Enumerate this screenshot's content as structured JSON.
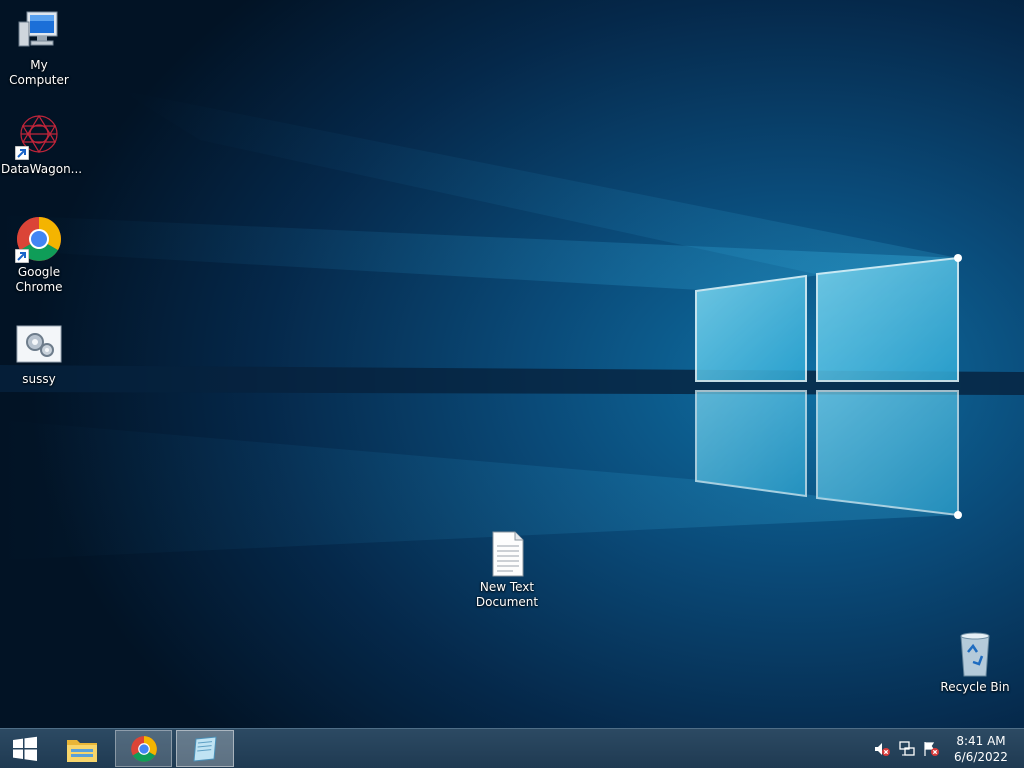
{
  "desktop": {
    "icons": [
      {
        "label": "My Computer",
        "icon": "computer-icon"
      },
      {
        "label": "DataWagon...",
        "icon": "datawagon-icon"
      },
      {
        "label": "Google\nChrome",
        "icon": "chrome-icon"
      },
      {
        "label": "sussy",
        "icon": "settings-file-icon"
      },
      {
        "label": "New Text\nDocument",
        "icon": "text-document-icon"
      },
      {
        "label": "Recycle Bin",
        "icon": "recycle-bin-icon"
      }
    ]
  },
  "taskbar": {
    "start_icon": "windows-logo-icon",
    "pinned": [
      {
        "name": "File Explorer",
        "icon": "folder-icon"
      },
      {
        "name": "Google Chrome",
        "icon": "chrome-icon"
      },
      {
        "name": "Notepad",
        "icon": "notepad-icon"
      }
    ],
    "tray": {
      "icons": [
        "volume-muted-icon",
        "network-icon",
        "action-center-flag-icon"
      ],
      "time": "8:41 AM",
      "date": "6/6/2022"
    }
  },
  "colors": {
    "wallpaper_dark": "#031a33",
    "wallpaper_glow": "#17a7d8",
    "taskbar": "#24425b"
  }
}
